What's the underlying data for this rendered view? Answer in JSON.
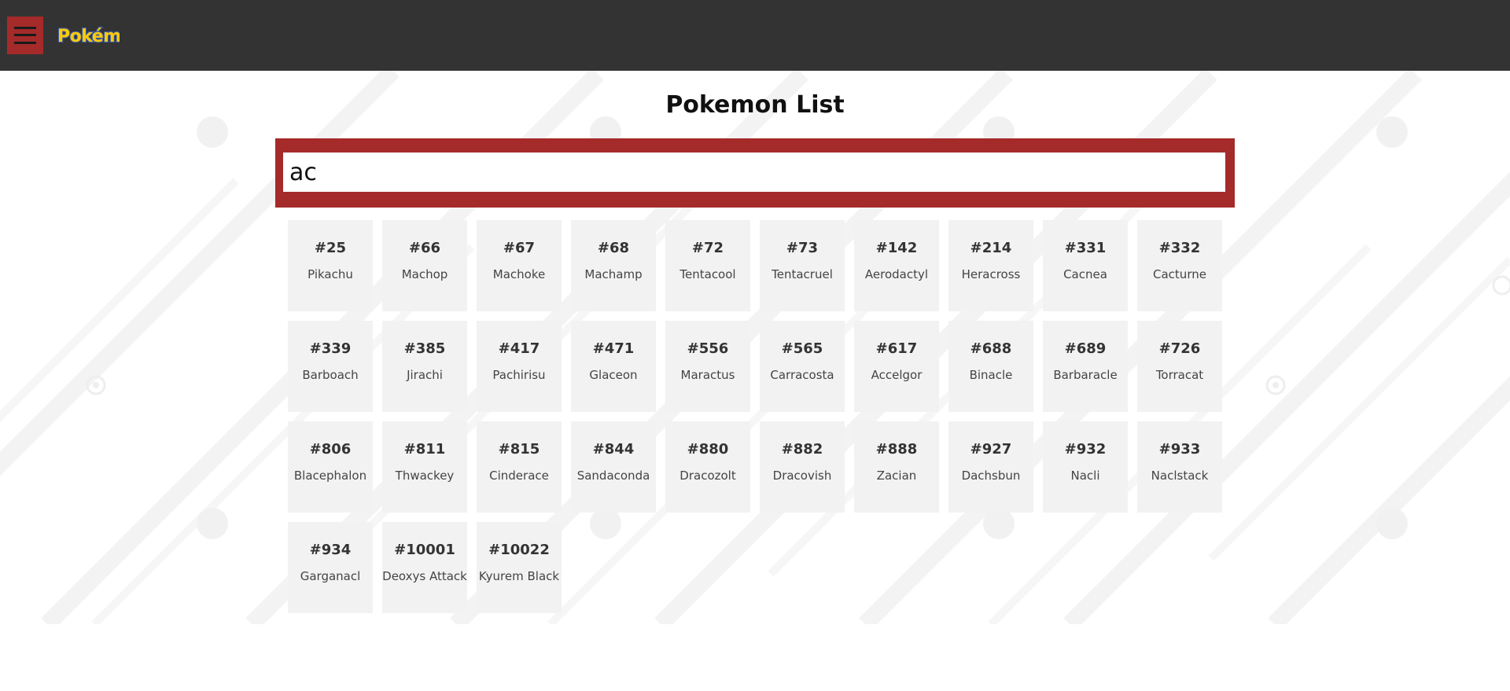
{
  "header": {
    "menu_icon": "hamburger-icon",
    "logo_text": "Pokémon",
    "colors": {
      "bar": "#333333",
      "accent": "#a52a2a",
      "logo_fill": "#ffcb05",
      "logo_stroke": "#3b5ba7"
    }
  },
  "main": {
    "title": "Pokemon List",
    "search": {
      "value": "ac",
      "placeholder": ""
    },
    "pokemon": [
      {
        "number": "#25",
        "name": "Pikachu"
      },
      {
        "number": "#66",
        "name": "Machop"
      },
      {
        "number": "#67",
        "name": "Machoke"
      },
      {
        "number": "#68",
        "name": "Machamp"
      },
      {
        "number": "#72",
        "name": "Tentacool"
      },
      {
        "number": "#73",
        "name": "Tentacruel"
      },
      {
        "number": "#142",
        "name": "Aerodactyl"
      },
      {
        "number": "#214",
        "name": "Heracross"
      },
      {
        "number": "#331",
        "name": "Cacnea"
      },
      {
        "number": "#332",
        "name": "Cacturne"
      },
      {
        "number": "#339",
        "name": "Barboach"
      },
      {
        "number": "#385",
        "name": "Jirachi"
      },
      {
        "number": "#417",
        "name": "Pachirisu"
      },
      {
        "number": "#471",
        "name": "Glaceon"
      },
      {
        "number": "#556",
        "name": "Maractus"
      },
      {
        "number": "#565",
        "name": "Carracosta"
      },
      {
        "number": "#617",
        "name": "Accelgor"
      },
      {
        "number": "#688",
        "name": "Binacle"
      },
      {
        "number": "#689",
        "name": "Barbaracle"
      },
      {
        "number": "#726",
        "name": "Torracat"
      },
      {
        "number": "#806",
        "name": "Blacephalon"
      },
      {
        "number": "#811",
        "name": "Thwackey"
      },
      {
        "number": "#815",
        "name": "Cinderace"
      },
      {
        "number": "#844",
        "name": "Sandaconda"
      },
      {
        "number": "#880",
        "name": "Dracozolt"
      },
      {
        "number": "#882",
        "name": "Dracovish"
      },
      {
        "number": "#888",
        "name": "Zacian"
      },
      {
        "number": "#927",
        "name": "Dachsbun"
      },
      {
        "number": "#932",
        "name": "Nacli"
      },
      {
        "number": "#933",
        "name": "Naclstack"
      },
      {
        "number": "#934",
        "name": "Garganacl"
      },
      {
        "number": "#10001",
        "name": "Deoxys Attack"
      },
      {
        "number": "#10022",
        "name": "Kyurem Black"
      }
    ]
  }
}
